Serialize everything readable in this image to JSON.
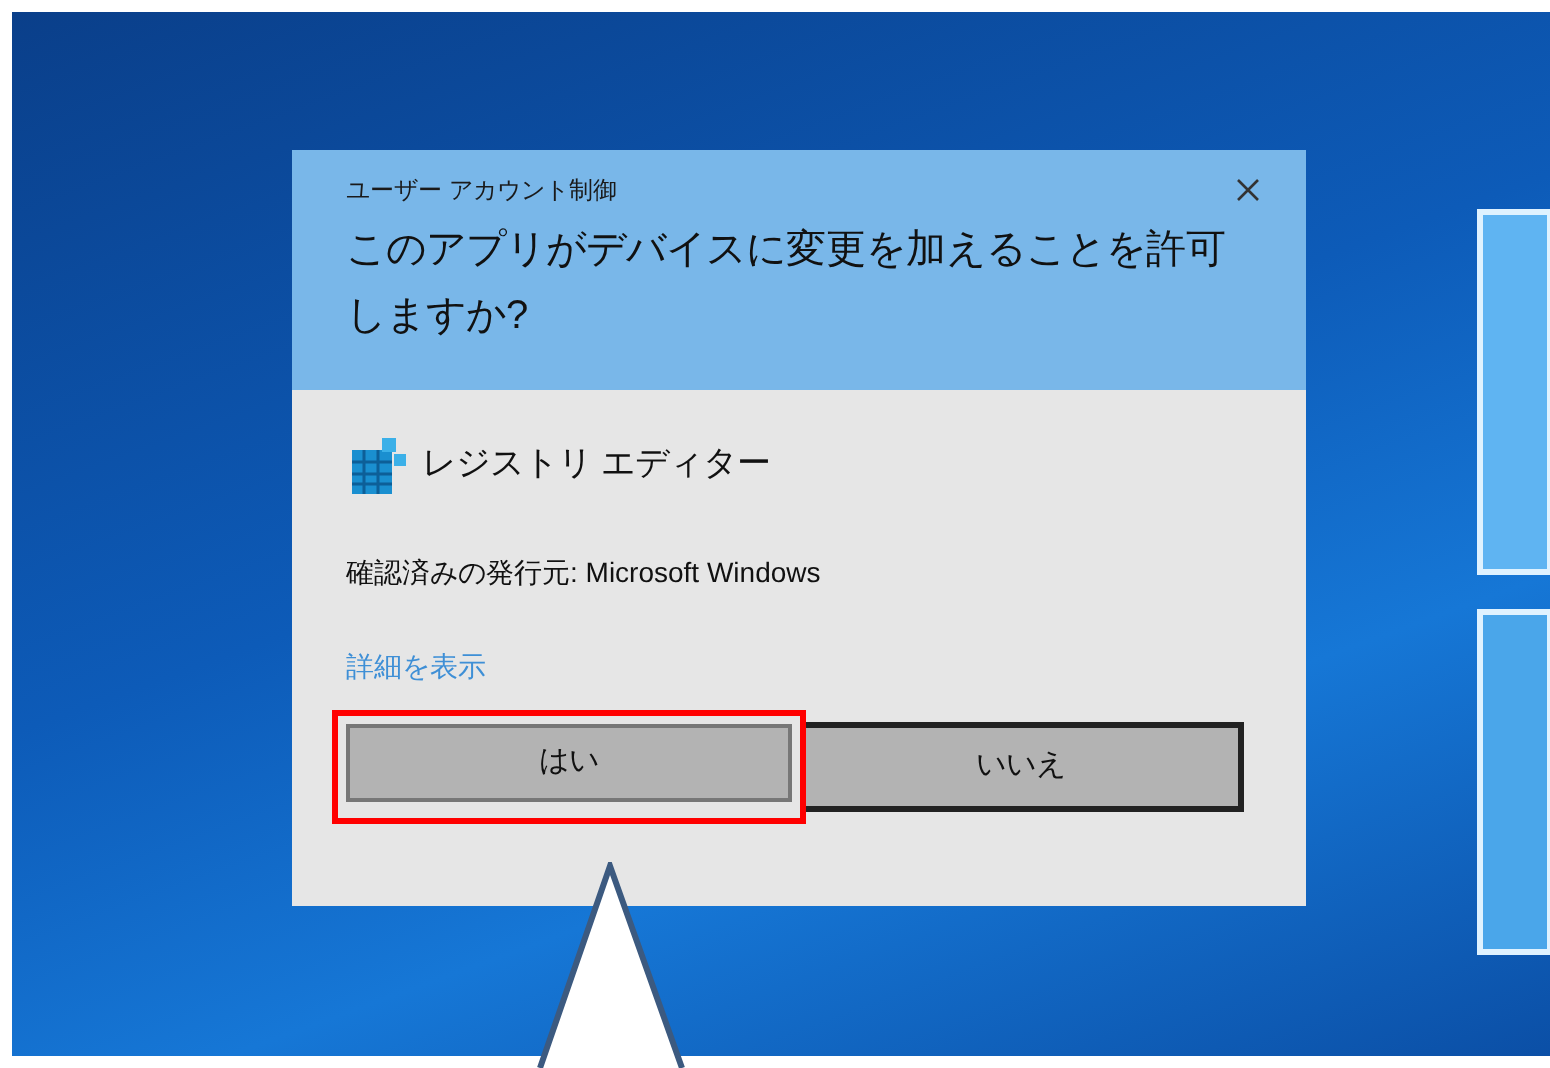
{
  "dialog": {
    "title": "ユーザー アカウント制御",
    "question": "このアプリがデバイスに変更を加えることを許可しますか?",
    "app_name": "レジストリ エディター",
    "publisher": "確認済みの発行元: Microsoft Windows",
    "details_link": "詳細を表示",
    "buttons": [
      {
        "label": "はい",
        "highlighted": true
      },
      {
        "label": "いいえ",
        "highlighted": false
      }
    ]
  }
}
